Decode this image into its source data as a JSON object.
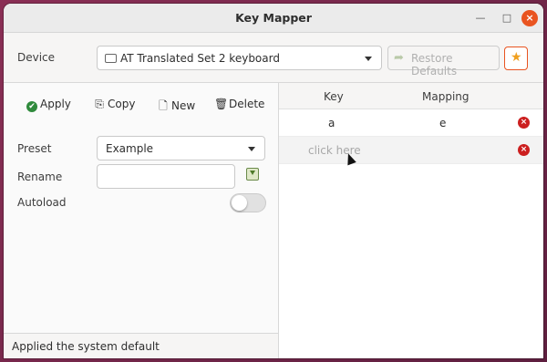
{
  "window": {
    "title": "Key Mapper"
  },
  "icons": {
    "minimize": "minimize-icon",
    "maximize": "maximize-icon",
    "close": "close-icon"
  },
  "topbar": {
    "device_label": "Device",
    "device_value": "AT Translated Set 2 keyboard",
    "restore_label": "Restore Defaults"
  },
  "toolbar": {
    "apply": "Apply",
    "copy": "Copy",
    "new": "New",
    "delete": "Delete"
  },
  "form": {
    "preset_label": "Preset",
    "preset_value": "Example",
    "rename_label": "Rename",
    "rename_value": "",
    "autoload_label": "Autoload",
    "autoload_on": false
  },
  "status": {
    "text": "Applied the system default"
  },
  "table": {
    "headers": {
      "key": "Key",
      "mapping": "Mapping"
    },
    "rows": [
      {
        "key": "a",
        "mapping": "e"
      },
      {
        "key": "",
        "mapping": "",
        "placeholder": "click here"
      }
    ]
  },
  "colors": {
    "accent": "#e95420",
    "apply_green": "#2f8a3c",
    "delete_red": "#cc1f1f"
  }
}
